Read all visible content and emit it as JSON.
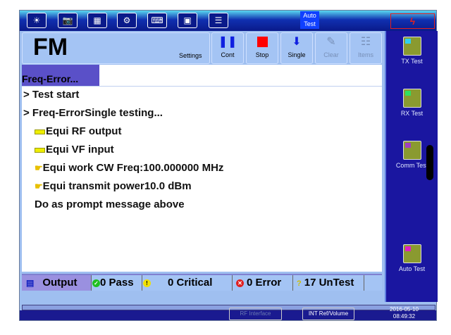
{
  "toolbar": {
    "icons": [
      "brightness-icon",
      "camera-icon",
      "printer-icon",
      "settings-gear-icon",
      "keyboard-icon",
      "save-icon",
      "report-icon"
    ],
    "auto_test_label": "Auto Test",
    "alarm_icon": "lightning-icon"
  },
  "header": {
    "mode": "FM",
    "settings_label": "Settings",
    "buttons": [
      {
        "label": "Cont",
        "icon": "pause-icon",
        "enabled": true
      },
      {
        "label": "Stop",
        "icon": "stop-icon",
        "enabled": true
      },
      {
        "label": "Single",
        "icon": "single-step-icon",
        "enabled": true
      },
      {
        "label": "Clear",
        "icon": "clear-brush-icon",
        "enabled": false
      },
      {
        "label": "Items",
        "icon": "items-list-icon",
        "enabled": false
      }
    ]
  },
  "tab": {
    "label": "Freq-Error..."
  },
  "log": [
    "> Test start",
    "> Freq-ErrorSingle testing...",
    "Equi RF output",
    "Equi VF input",
    "Equi work CW Freq:100.000000 MHz",
    "Equi transmit power10.0 dBm",
    "Do as prompt message above"
  ],
  "status": {
    "output": "Output",
    "pass": "0 Pass",
    "critical": "0 Critical",
    "error": "0 Error",
    "untest": "17 UnTest"
  },
  "sidebar": {
    "items": [
      {
        "label": "TX Test"
      },
      {
        "label": "RX Test"
      },
      {
        "label": "Comm Test"
      },
      {
        "label": "Auto Test"
      }
    ]
  },
  "bottom": {
    "rf_interface": "RF Interface",
    "int_ref": "INT Ref/Volume",
    "date": "2016-05-10",
    "time": "08:49:32"
  },
  "colors": {
    "titlebar": "#0a1a8a",
    "sidebar": "#1a16a0",
    "panel": "#a4c4f4",
    "tab": "#5a50c8"
  }
}
